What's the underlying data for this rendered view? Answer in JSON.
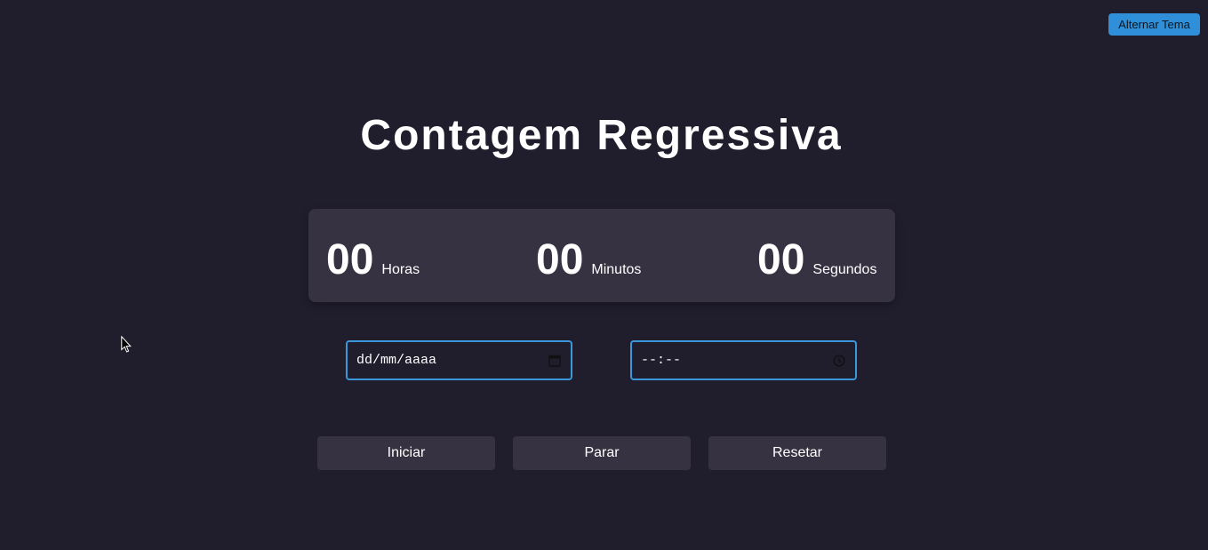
{
  "header": {
    "theme_toggle_label": "Alternar Tema"
  },
  "main": {
    "title": "Contagem Regressiva",
    "timer": {
      "hours": {
        "value": "00",
        "label": "Horas"
      },
      "minutes": {
        "value": "00",
        "label": "Minutos"
      },
      "seconds": {
        "value": "00",
        "label": "Segundos"
      }
    },
    "inputs": {
      "date": {
        "value": "dd/mm/aaaa",
        "icon": "calendar-icon"
      },
      "time": {
        "value": "--:--",
        "icon": "clock-icon"
      }
    },
    "buttons": {
      "start_label": "Iniciar",
      "stop_label": "Parar",
      "reset_label": "Resetar"
    }
  },
  "colors": {
    "background": "#201d2d",
    "card": "#363241",
    "accent": "#3b96dc",
    "toggle": "#2f8fd8",
    "text": "#ffffff"
  }
}
